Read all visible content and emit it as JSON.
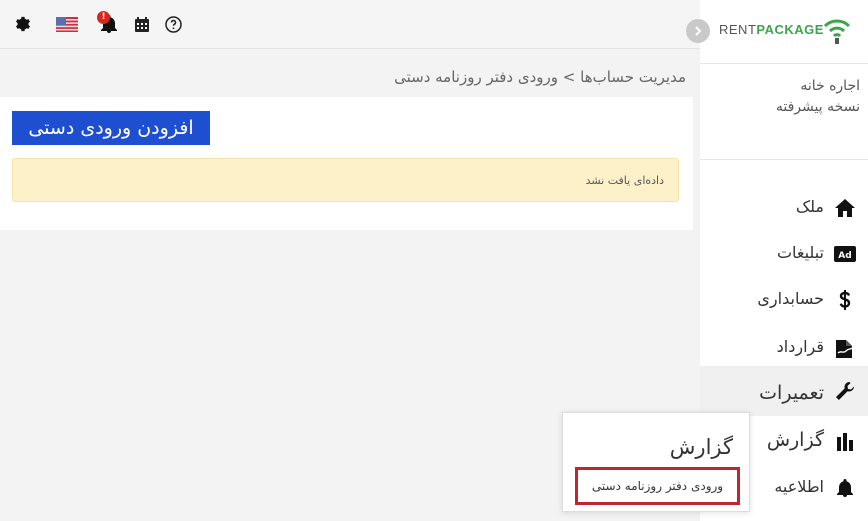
{
  "topbar": {
    "notification_count": "!"
  },
  "brand": {
    "rent": "RENT",
    "package": "PACKAGE"
  },
  "plan": {
    "line1": "اجاره خانه",
    "line2": "نسخه پیشرفته"
  },
  "breadcrumb": "مدیریت حساب‌ها > ورودی دفتر روزنامه دستی",
  "main": {
    "add_button": "افزودن ورودی دستی",
    "empty_message": "داده‌ای یافت نشد"
  },
  "sidebar": {
    "items": [
      {
        "label": "ملک",
        "icon": "home-icon"
      },
      {
        "label": "تبلیغات",
        "icon": "ad-icon"
      },
      {
        "label": "حسابداری",
        "icon": "currency-icon"
      },
      {
        "label": "قرارداد",
        "icon": "contract-icon"
      },
      {
        "label": "تعمیرات",
        "icon": "wrench-icon"
      },
      {
        "label": "گزارش",
        "icon": "chart-icon"
      },
      {
        "label": "اطلاعیه",
        "icon": "bell-icon"
      }
    ]
  },
  "popup": {
    "title": "گزارش",
    "item": "ورودی دفتر روزنامه دستی"
  },
  "colors": {
    "primary_button": "#1f4fd1",
    "alert_bg": "#fdf1c9",
    "brand_green": "#3aa64a",
    "highlight_border": "#c0262d",
    "badge": "#d9261c"
  }
}
